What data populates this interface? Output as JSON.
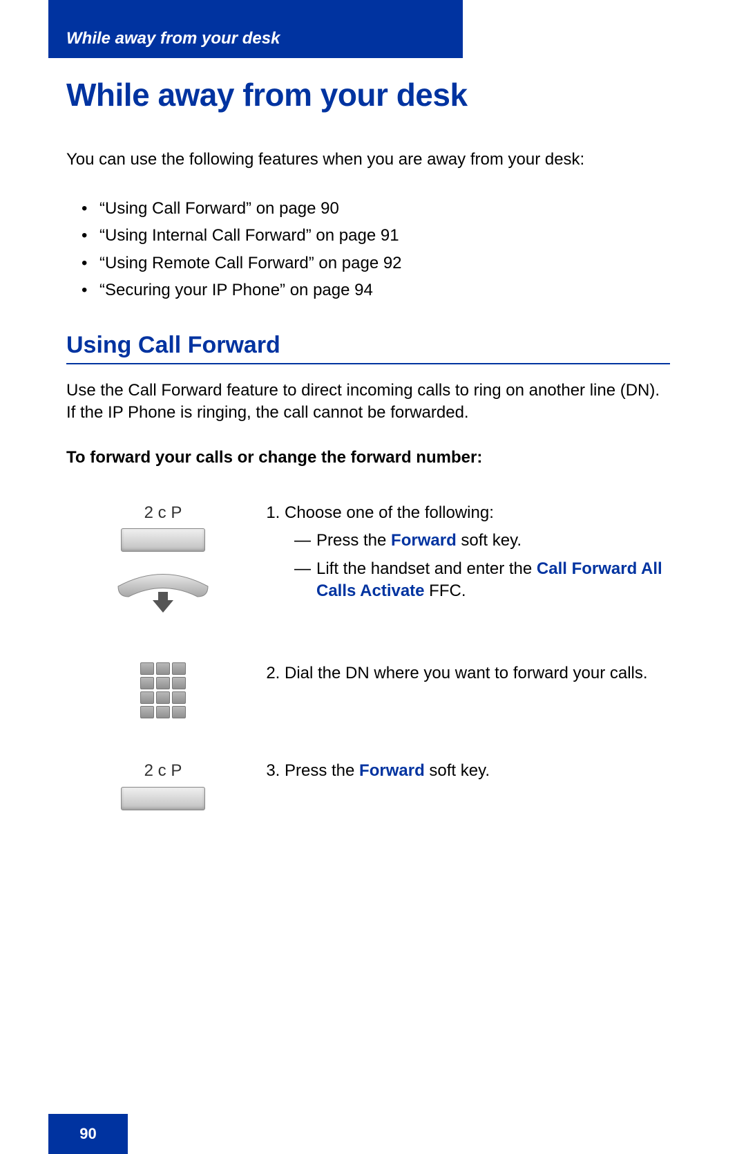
{
  "header": {
    "tab_title": "While away from your desk"
  },
  "title": "While away from your desk",
  "intro": "You can use the following features when you are away from your desk:",
  "bullets": [
    "“Using Call Forward” on page 90",
    "“Using Internal Call Forward” on page 91",
    "“Using Remote Call Forward” on page 92",
    "“Securing your IP Phone” on page 94"
  ],
  "section_title": "Using Call Forward",
  "section_para": "Use the Call Forward feature to direct incoming calls to ring on another line (DN). If the IP Phone is ringing, the call cannot be forwarded.",
  "sub_head": "To forward your calls or change the forward number:",
  "softkey_label": "2 c P",
  "steps": {
    "s1": {
      "lead": "Choose one of the following:",
      "opt_a_pre": "Press the ",
      "opt_a_kw": "Forward",
      "opt_a_post": " soft key.",
      "opt_b_pre": "Lift the handset and enter the ",
      "opt_b_kw": "Call Forward All Calls Activate",
      "opt_b_post": " FFC."
    },
    "s2": "Dial the DN where you want to forward your calls.",
    "s3_pre": "Press the ",
    "s3_kw": "Forward",
    "s3_post": " soft key."
  },
  "page_number": "90"
}
